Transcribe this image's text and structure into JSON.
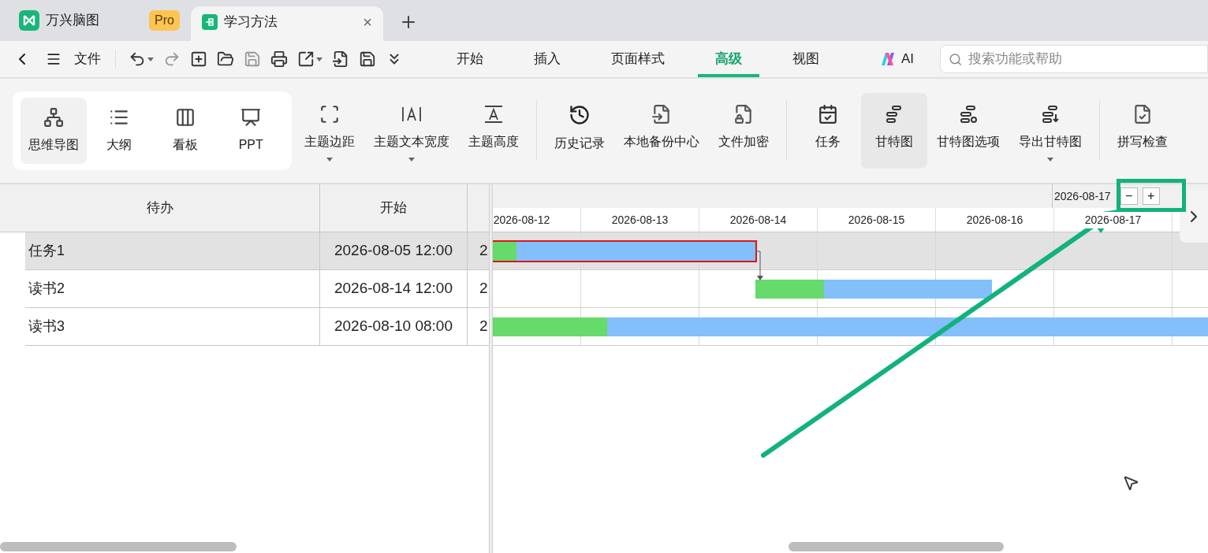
{
  "app_tab": {
    "title": "万兴脑图",
    "badge": "Pro"
  },
  "doc_tab": {
    "title": "学习方法",
    "close": "×",
    "selected": true
  },
  "menu_bar": {
    "file": "文件",
    "tabs": [
      {
        "label": "开始",
        "selected": false
      },
      {
        "label": "插入",
        "selected": false
      },
      {
        "label": "页面样式",
        "selected": false
      },
      {
        "label": "高级",
        "selected": true
      },
      {
        "label": "视图",
        "selected": false
      },
      {
        "label": "AI",
        "selected": false
      }
    ],
    "search": {
      "placeholder": "搜索功能或帮助"
    }
  },
  "view_modes": [
    {
      "label": "思维导图",
      "selected": true
    },
    {
      "label": "大纲",
      "selected": false
    },
    {
      "label": "看板",
      "selected": false
    },
    {
      "label": "PPT",
      "selected": false
    }
  ],
  "ribbon_groups": [
    [
      {
        "label": "主题边距",
        "has_dropdown": true,
        "selected": false
      },
      {
        "label": "主题文本宽度",
        "has_dropdown": true,
        "selected": false
      },
      {
        "label": "主题高度",
        "has_dropdown": false,
        "selected": false
      }
    ],
    [
      {
        "label": "历史记录",
        "has_dropdown": false,
        "selected": false
      },
      {
        "label": "本地备份中心",
        "has_dropdown": false,
        "selected": false
      },
      {
        "label": "文件加密",
        "has_dropdown": false,
        "selected": false
      }
    ],
    [
      {
        "label": "任务",
        "has_dropdown": false,
        "selected": false
      },
      {
        "label": "甘特图",
        "has_dropdown": false,
        "selected": true
      },
      {
        "label": "甘特图选项",
        "has_dropdown": false,
        "selected": false
      },
      {
        "label": "导出甘特图",
        "has_dropdown": true,
        "selected": false
      }
    ],
    [
      {
        "label": "拼写检查",
        "has_dropdown": false,
        "selected": false
      }
    ]
  ],
  "table": {
    "columns": [
      "待办",
      "开始"
    ],
    "rows": [
      {
        "task": "任务1",
        "start": "2026-08-05 12:00",
        "column_3": "2",
        "selected": true,
        "level": 0.09
      },
      {
        "task": "读书2",
        "start": "2026-08-14 12:00",
        "column_3": "2",
        "selected": false,
        "level": 0.29
      },
      {
        "task": "读书3",
        "start": "2026-08-10 08:00",
        "column_3": "2",
        "selected": false,
        "level": 0.16
      }
    ]
  },
  "gantt": {
    "top_date": "2026-08-17",
    "zoom_out": "−",
    "zoom_in": "+",
    "days": [
      "2026-08-12",
      "2026-08-13",
      "2026-08-14",
      "2026-08-15",
      "2026-08-16",
      "2026-08-17"
    ]
  }
}
